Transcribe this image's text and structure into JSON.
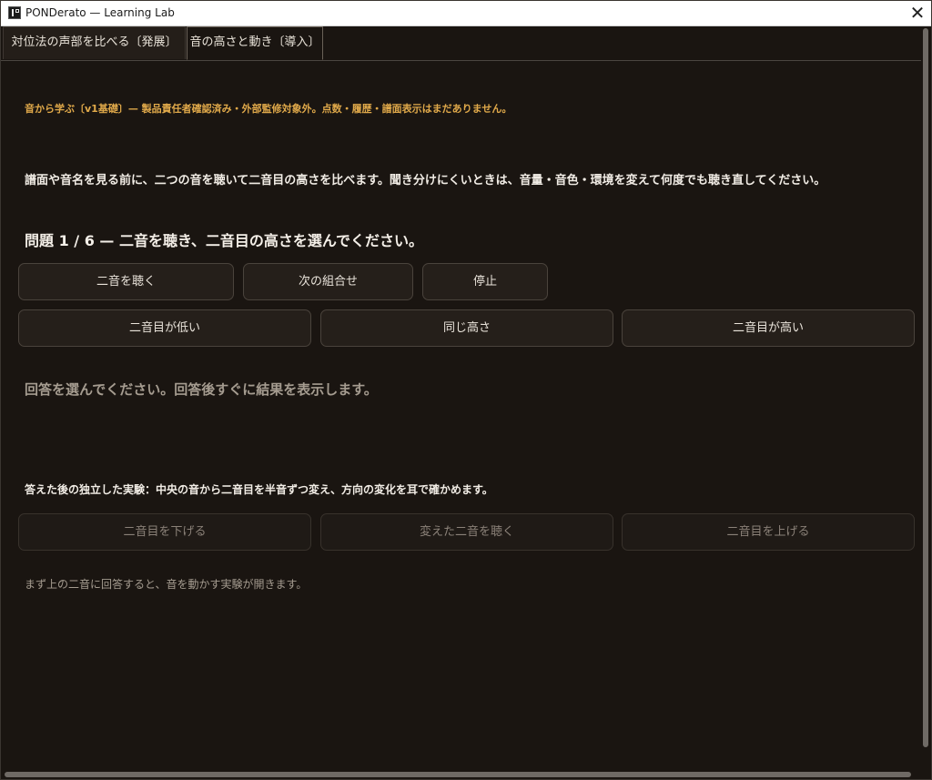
{
  "window": {
    "title": "PONDerato — Learning Lab",
    "close_icon": "close-icon"
  },
  "tabs": [
    {
      "label": "対位法の声部を比べる〔発展〕",
      "active": false
    },
    {
      "label": "音の高さと動き〔導入〕",
      "active": true
    }
  ],
  "main": {
    "notice": "音から学ぶ〔v1基礎〕— 製品責任者確認済み・外部監修対象外。点数・履歴・譜面表示はまだありません。",
    "intro": "譜面や音名を見る前に、二つの音を聴いて二音目の高さを比べます。聞き分けにくいときは、音量・音色・環境を変えて何度でも聴き直してください。",
    "question": "問題 1 / 6 — 二音を聴き、二音目の高さを選んでください。",
    "controls": {
      "listen": "二音を聴く",
      "next": "次の組合せ",
      "stop": "停止"
    },
    "answers": {
      "lower": "二音目が低い",
      "same": "同じ高さ",
      "higher": "二音目が高い"
    },
    "feedback": "回答を選んでください。回答後すぐに結果を表示します。",
    "experiment": {
      "heading": "答えた後の独立した実験：中央の音から二音目を半音ずつ変え、方向の変化を耳で確かめます。",
      "down": "二音目を下げる",
      "play_changed": "変えた二音を聴く",
      "up": "二音目を上げる",
      "hint": "まず上の二音に回答すると、音を動かす実験が開きます。"
    }
  },
  "colors": {
    "background": "#1a1511",
    "notice": "#e0a94a",
    "button_bg": "#251f1a",
    "muted_text": "#a59c90"
  }
}
